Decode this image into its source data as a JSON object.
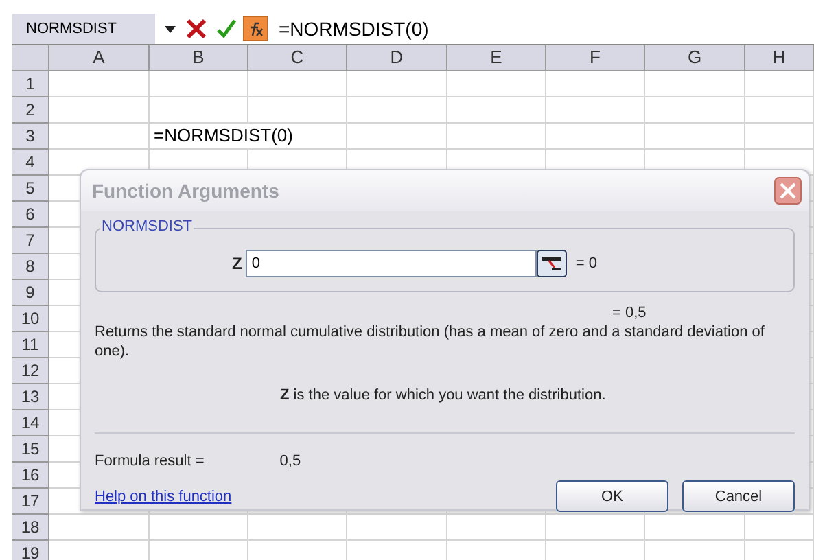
{
  "formula_bar": {
    "name_box": "NORMSDIST",
    "formula": "=NORMSDIST(0)"
  },
  "columns": [
    "A",
    "B",
    "C",
    "D",
    "E",
    "F",
    "G",
    "H"
  ],
  "rows": [
    {
      "label": "1"
    },
    {
      "label": "2"
    },
    {
      "label": "3",
      "text": "=NORMSDIST(0)"
    },
    {
      "label": "4"
    },
    {
      "label": "5"
    },
    {
      "label": "6"
    },
    {
      "label": "7"
    },
    {
      "label": "8"
    },
    {
      "label": "9"
    },
    {
      "label": "10"
    },
    {
      "label": "11"
    },
    {
      "label": "12"
    },
    {
      "label": "13"
    },
    {
      "label": "14"
    },
    {
      "label": "15"
    },
    {
      "label": "16"
    },
    {
      "label": "17"
    },
    {
      "label": "18"
    },
    {
      "label": "19"
    }
  ],
  "dialog": {
    "title": "Function Arguments",
    "group_label": "NORMSDIST",
    "argument": {
      "label": "Z",
      "value": "0",
      "result": "= 0"
    },
    "overall_result": "= 0,5",
    "description": "Returns the standard normal cumulative distribution (has a mean of zero and a standard deviation of one).",
    "argument_help": "**Z** is the value for which you want the distribution.",
    "formula_result_label": "Formula result =",
    "formula_result_value": "0,5",
    "help_link": "Help on this function",
    "buttons": [
      "OK",
      "Cancel"
    ]
  }
}
